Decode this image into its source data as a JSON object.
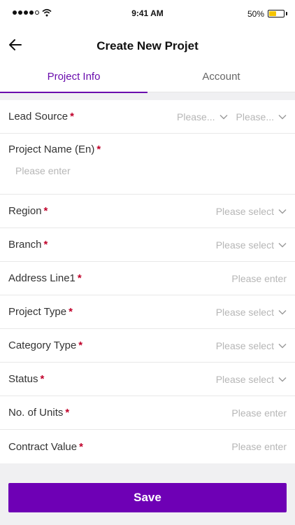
{
  "status_bar": {
    "time": "9:41 AM",
    "battery_text": "50%",
    "battery_level": 0.5
  },
  "nav": {
    "title": "Create New Projet"
  },
  "tabs": [
    {
      "label": "Project Info",
      "active": true
    },
    {
      "label": "Account",
      "active": false
    }
  ],
  "form": {
    "lead_source": {
      "label": "Lead Source",
      "placeholder_1": "Please...",
      "placeholder_2": "Please..."
    },
    "project_name": {
      "label": "Project Name (En)",
      "placeholder": "Please enter"
    },
    "region": {
      "label": "Region",
      "placeholder": "Please select"
    },
    "branch": {
      "label": "Branch",
      "placeholder": "Please select"
    },
    "address_line1": {
      "label": "Address Line1",
      "placeholder": "Please enter"
    },
    "project_type": {
      "label": "Project Type",
      "placeholder": "Please select"
    },
    "category_type": {
      "label": "Category Type",
      "placeholder": "Please select"
    },
    "status": {
      "label": "Status",
      "placeholder": "Please select"
    },
    "no_of_units": {
      "label": "No. of Units",
      "placeholder": "Please enter"
    },
    "contract_value": {
      "label": "Contract Value",
      "placeholder": "Please enter"
    }
  },
  "required_marker": "*",
  "save_label": "Save",
  "colors": {
    "accent": "#6a0dad",
    "button": "#6e00b5",
    "required": "#c0002a",
    "placeholder": "#b6b6b6"
  }
}
